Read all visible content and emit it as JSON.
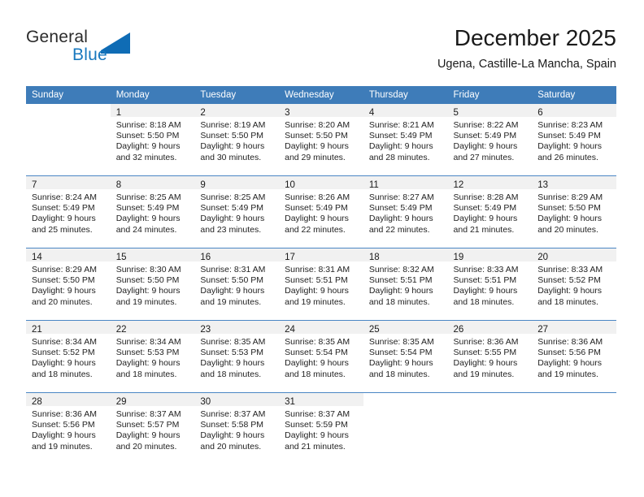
{
  "brand": {
    "name_top": "General",
    "name_bottom": "Blue",
    "accent_color": "#0f6cb5"
  },
  "header": {
    "title": "December 2025",
    "subtitle": "Ugena, Castille-La Mancha, Spain"
  },
  "theme": {
    "header_bg": "#3e7cb9",
    "row_divider": "#4a86c4",
    "daynum_bg": "#f1f1f1"
  },
  "weekday_headers": [
    "Sunday",
    "Monday",
    "Tuesday",
    "Wednesday",
    "Thursday",
    "Friday",
    "Saturday"
  ],
  "weeks": [
    [
      {
        "day": ""
      },
      {
        "day": "1",
        "sunrise": "Sunrise: 8:18 AM",
        "sunset": "Sunset: 5:50 PM",
        "daylight_1": "Daylight: 9 hours",
        "daylight_2": "and 32 minutes."
      },
      {
        "day": "2",
        "sunrise": "Sunrise: 8:19 AM",
        "sunset": "Sunset: 5:50 PM",
        "daylight_1": "Daylight: 9 hours",
        "daylight_2": "and 30 minutes."
      },
      {
        "day": "3",
        "sunrise": "Sunrise: 8:20 AM",
        "sunset": "Sunset: 5:50 PM",
        "daylight_1": "Daylight: 9 hours",
        "daylight_2": "and 29 minutes."
      },
      {
        "day": "4",
        "sunrise": "Sunrise: 8:21 AM",
        "sunset": "Sunset: 5:49 PM",
        "daylight_1": "Daylight: 9 hours",
        "daylight_2": "and 28 minutes."
      },
      {
        "day": "5",
        "sunrise": "Sunrise: 8:22 AM",
        "sunset": "Sunset: 5:49 PM",
        "daylight_1": "Daylight: 9 hours",
        "daylight_2": "and 27 minutes."
      },
      {
        "day": "6",
        "sunrise": "Sunrise: 8:23 AM",
        "sunset": "Sunset: 5:49 PM",
        "daylight_1": "Daylight: 9 hours",
        "daylight_2": "and 26 minutes."
      }
    ],
    [
      {
        "day": "7",
        "sunrise": "Sunrise: 8:24 AM",
        "sunset": "Sunset: 5:49 PM",
        "daylight_1": "Daylight: 9 hours",
        "daylight_2": "and 25 minutes."
      },
      {
        "day": "8",
        "sunrise": "Sunrise: 8:25 AM",
        "sunset": "Sunset: 5:49 PM",
        "daylight_1": "Daylight: 9 hours",
        "daylight_2": "and 24 minutes."
      },
      {
        "day": "9",
        "sunrise": "Sunrise: 8:25 AM",
        "sunset": "Sunset: 5:49 PM",
        "daylight_1": "Daylight: 9 hours",
        "daylight_2": "and 23 minutes."
      },
      {
        "day": "10",
        "sunrise": "Sunrise: 8:26 AM",
        "sunset": "Sunset: 5:49 PM",
        "daylight_1": "Daylight: 9 hours",
        "daylight_2": "and 22 minutes."
      },
      {
        "day": "11",
        "sunrise": "Sunrise: 8:27 AM",
        "sunset": "Sunset: 5:49 PM",
        "daylight_1": "Daylight: 9 hours",
        "daylight_2": "and 22 minutes."
      },
      {
        "day": "12",
        "sunrise": "Sunrise: 8:28 AM",
        "sunset": "Sunset: 5:49 PM",
        "daylight_1": "Daylight: 9 hours",
        "daylight_2": "and 21 minutes."
      },
      {
        "day": "13",
        "sunrise": "Sunrise: 8:29 AM",
        "sunset": "Sunset: 5:50 PM",
        "daylight_1": "Daylight: 9 hours",
        "daylight_2": "and 20 minutes."
      }
    ],
    [
      {
        "day": "14",
        "sunrise": "Sunrise: 8:29 AM",
        "sunset": "Sunset: 5:50 PM",
        "daylight_1": "Daylight: 9 hours",
        "daylight_2": "and 20 minutes."
      },
      {
        "day": "15",
        "sunrise": "Sunrise: 8:30 AM",
        "sunset": "Sunset: 5:50 PM",
        "daylight_1": "Daylight: 9 hours",
        "daylight_2": "and 19 minutes."
      },
      {
        "day": "16",
        "sunrise": "Sunrise: 8:31 AM",
        "sunset": "Sunset: 5:50 PM",
        "daylight_1": "Daylight: 9 hours",
        "daylight_2": "and 19 minutes."
      },
      {
        "day": "17",
        "sunrise": "Sunrise: 8:31 AM",
        "sunset": "Sunset: 5:51 PM",
        "daylight_1": "Daylight: 9 hours",
        "daylight_2": "and 19 minutes."
      },
      {
        "day": "18",
        "sunrise": "Sunrise: 8:32 AM",
        "sunset": "Sunset: 5:51 PM",
        "daylight_1": "Daylight: 9 hours",
        "daylight_2": "and 18 minutes."
      },
      {
        "day": "19",
        "sunrise": "Sunrise: 8:33 AM",
        "sunset": "Sunset: 5:51 PM",
        "daylight_1": "Daylight: 9 hours",
        "daylight_2": "and 18 minutes."
      },
      {
        "day": "20",
        "sunrise": "Sunrise: 8:33 AM",
        "sunset": "Sunset: 5:52 PM",
        "daylight_1": "Daylight: 9 hours",
        "daylight_2": "and 18 minutes."
      }
    ],
    [
      {
        "day": "21",
        "sunrise": "Sunrise: 8:34 AM",
        "sunset": "Sunset: 5:52 PM",
        "daylight_1": "Daylight: 9 hours",
        "daylight_2": "and 18 minutes."
      },
      {
        "day": "22",
        "sunrise": "Sunrise: 8:34 AM",
        "sunset": "Sunset: 5:53 PM",
        "daylight_1": "Daylight: 9 hours",
        "daylight_2": "and 18 minutes."
      },
      {
        "day": "23",
        "sunrise": "Sunrise: 8:35 AM",
        "sunset": "Sunset: 5:53 PM",
        "daylight_1": "Daylight: 9 hours",
        "daylight_2": "and 18 minutes."
      },
      {
        "day": "24",
        "sunrise": "Sunrise: 8:35 AM",
        "sunset": "Sunset: 5:54 PM",
        "daylight_1": "Daylight: 9 hours",
        "daylight_2": "and 18 minutes."
      },
      {
        "day": "25",
        "sunrise": "Sunrise: 8:35 AM",
        "sunset": "Sunset: 5:54 PM",
        "daylight_1": "Daylight: 9 hours",
        "daylight_2": "and 18 minutes."
      },
      {
        "day": "26",
        "sunrise": "Sunrise: 8:36 AM",
        "sunset": "Sunset: 5:55 PM",
        "daylight_1": "Daylight: 9 hours",
        "daylight_2": "and 19 minutes."
      },
      {
        "day": "27",
        "sunrise": "Sunrise: 8:36 AM",
        "sunset": "Sunset: 5:56 PM",
        "daylight_1": "Daylight: 9 hours",
        "daylight_2": "and 19 minutes."
      }
    ],
    [
      {
        "day": "28",
        "sunrise": "Sunrise: 8:36 AM",
        "sunset": "Sunset: 5:56 PM",
        "daylight_1": "Daylight: 9 hours",
        "daylight_2": "and 19 minutes."
      },
      {
        "day": "29",
        "sunrise": "Sunrise: 8:37 AM",
        "sunset": "Sunset: 5:57 PM",
        "daylight_1": "Daylight: 9 hours",
        "daylight_2": "and 20 minutes."
      },
      {
        "day": "30",
        "sunrise": "Sunrise: 8:37 AM",
        "sunset": "Sunset: 5:58 PM",
        "daylight_1": "Daylight: 9 hours",
        "daylight_2": "and 20 minutes."
      },
      {
        "day": "31",
        "sunrise": "Sunrise: 8:37 AM",
        "sunset": "Sunset: 5:59 PM",
        "daylight_1": "Daylight: 9 hours",
        "daylight_2": "and 21 minutes."
      },
      {
        "day": ""
      },
      {
        "day": ""
      },
      {
        "day": ""
      }
    ]
  ]
}
